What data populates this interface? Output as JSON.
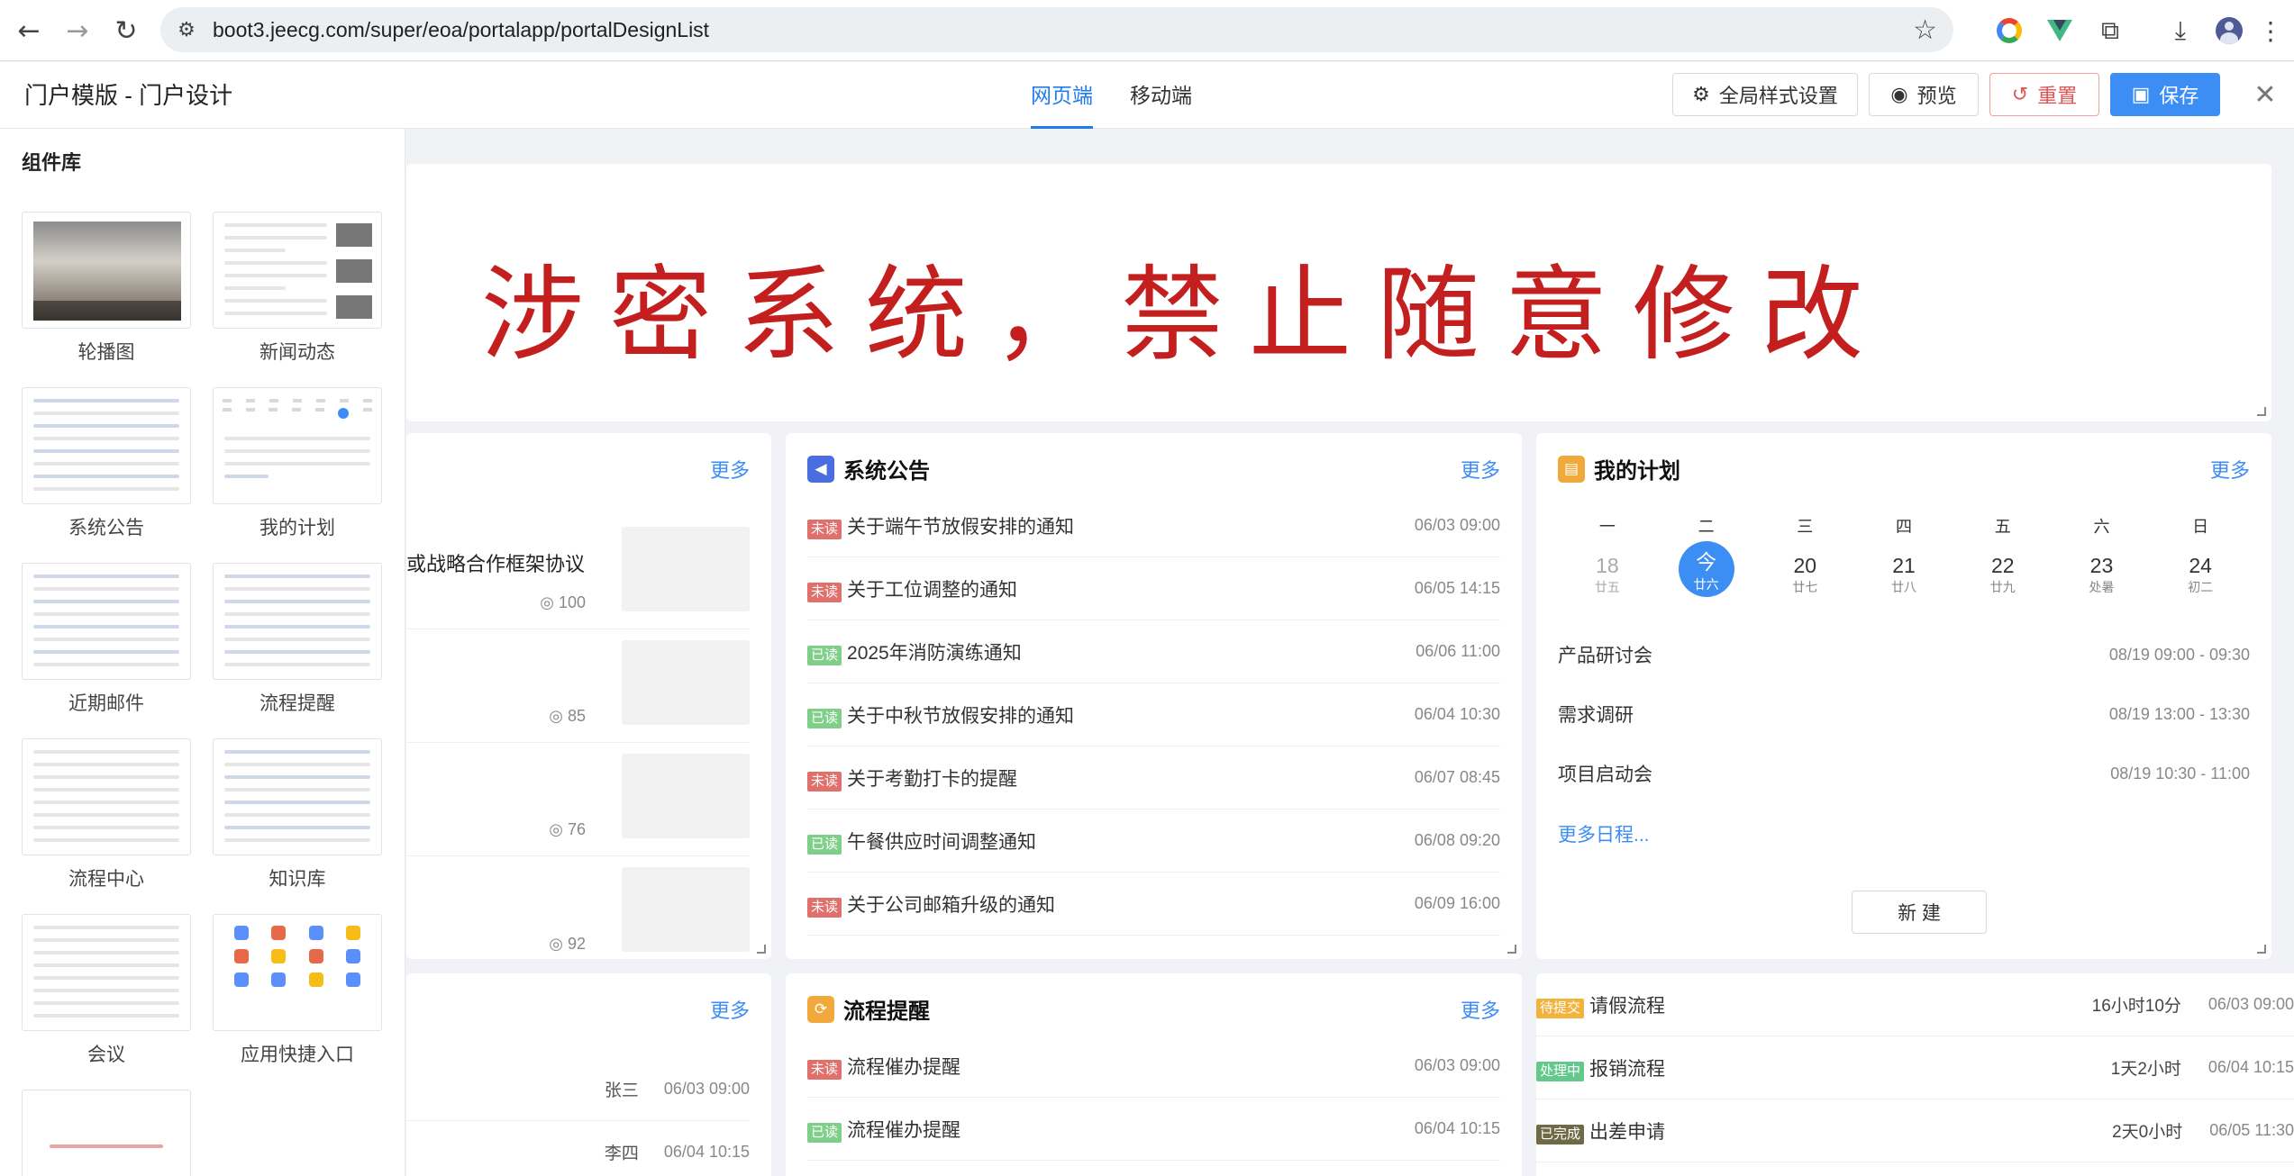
{
  "browser": {
    "url": "boot3.jeecg.com/super/eoa/portalapp/portalDesignList"
  },
  "header": {
    "title": "门户模版 - 门户设计",
    "tabs": [
      {
        "label": "网页端",
        "active": true
      },
      {
        "label": "移动端",
        "active": false
      }
    ],
    "buttons": {
      "global_style": "全局样式设置",
      "preview": "预览",
      "reset": "重置",
      "save": "保存"
    }
  },
  "sidebar": {
    "title": "组件库",
    "components": [
      "轮播图",
      "新闻动态",
      "系统公告",
      "我的计划",
      "近期邮件",
      "流程提醒",
      "流程中心",
      "知识库",
      "会议",
      "应用快捷入口"
    ]
  },
  "banner": {
    "text": "涉密系统，禁止随意修改"
  },
  "news": {
    "more": "更多",
    "items": [
      {
        "title": "或战略合作框架协议",
        "views": "100"
      },
      {
        "title": "",
        "views": "85"
      },
      {
        "title": "",
        "views": "76"
      },
      {
        "title": "",
        "views": "92"
      }
    ]
  },
  "announcements": {
    "title": "系统公告",
    "more": "更多",
    "items": [
      {
        "status": "未读",
        "state": "unread",
        "title": "关于端午节放假安排的通知",
        "date": "06/03 09:00"
      },
      {
        "status": "未读",
        "state": "unread",
        "title": "关于工位调整的通知",
        "date": "06/05 14:15"
      },
      {
        "status": "已读",
        "state": "read",
        "title": "2025年消防演练通知",
        "date": "06/06 11:00"
      },
      {
        "status": "已读",
        "state": "read",
        "title": "关于中秋节放假安排的通知",
        "date": "06/04 10:30"
      },
      {
        "status": "未读",
        "state": "unread",
        "title": "关于考勤打卡的提醒",
        "date": "06/07 08:45"
      },
      {
        "status": "已读",
        "state": "read",
        "title": "午餐供应时间调整通知",
        "date": "06/08 09:20"
      },
      {
        "status": "未读",
        "state": "unread",
        "title": "关于公司邮箱升级的通知",
        "date": "06/09 16:00"
      }
    ]
  },
  "plan": {
    "title": "我的计划",
    "more": "更多",
    "weekdays": [
      "一",
      "二",
      "三",
      "四",
      "五",
      "六",
      "日"
    ],
    "days": [
      {
        "num": "18",
        "lunar": "廿五",
        "type": "past"
      },
      {
        "num": "今",
        "lunar": "廿六",
        "type": "today"
      },
      {
        "num": "20",
        "lunar": "廿七",
        "type": "normal"
      },
      {
        "num": "21",
        "lunar": "廿八",
        "type": "normal"
      },
      {
        "num": "22",
        "lunar": "廿九",
        "type": "normal"
      },
      {
        "num": "23",
        "lunar": "处暑",
        "type": "normal"
      },
      {
        "num": "24",
        "lunar": "初二",
        "type": "normal"
      }
    ],
    "events": [
      {
        "title": "产品研讨会",
        "time": "08/19 09:00 - 09:30"
      },
      {
        "title": "需求调研",
        "time": "08/19 13:00 - 13:30"
      },
      {
        "title": "项目启动会",
        "time": "08/19 10:30 - 11:00"
      }
    ],
    "more_schedule": "更多日程...",
    "new_button": "新 建"
  },
  "mail": {
    "more": "更多",
    "items": [
      {
        "sender": "张三",
        "date": "06/03 09:00"
      },
      {
        "sender": "李四",
        "date": "06/04 10:15"
      }
    ]
  },
  "flow_reminder": {
    "title": "流程提醒",
    "more": "更多",
    "items": [
      {
        "status": "未读",
        "state": "unread",
        "title": "流程催办提醒",
        "date": "06/03 09:00"
      },
      {
        "status": "已读",
        "state": "read",
        "title": "流程催办提醒",
        "date": "06/04 10:15"
      }
    ]
  },
  "flow_center": {
    "items": [
      {
        "status": "待提交",
        "state": "pending",
        "title": "请假流程",
        "duration": "16小时10分",
        "date": "06/03 09:00"
      },
      {
        "status": "处理中",
        "state": "doing",
        "title": "报销流程",
        "duration": "1天2小时",
        "date": "06/04 10:15"
      },
      {
        "status": "已完成",
        "state": "done",
        "title": "出差申请",
        "duration": "2天0小时",
        "date": "06/05 11:30"
      }
    ]
  },
  "colors": {
    "accent": "#1f7bef",
    "banner_red": "#c41f1f",
    "unread_tag": "#e0706c",
    "read_tag": "#7fcf8a"
  }
}
